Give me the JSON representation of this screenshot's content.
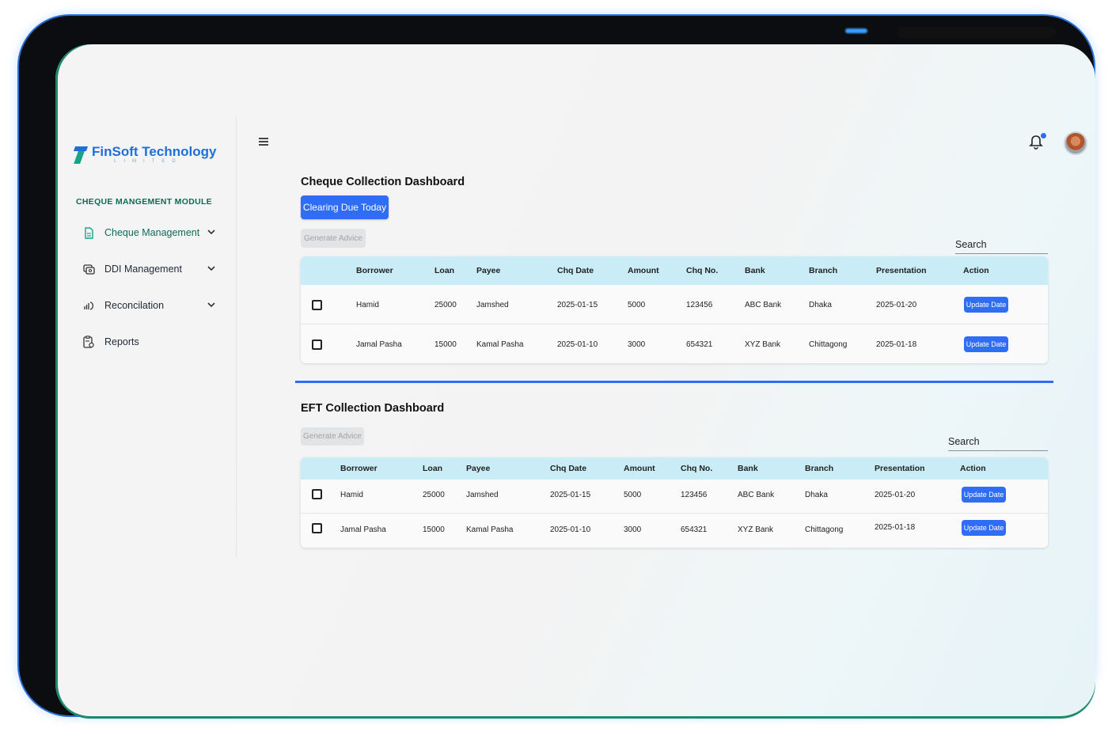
{
  "brand": {
    "name_part1": "FinSoft",
    "name_part2": "Technology",
    "subtitle": "LIMITED"
  },
  "sidebar": {
    "module_title": "CHEQUE MANGEMENT MODULE",
    "items": [
      {
        "label": "Cheque Management",
        "icon": "document-icon",
        "has_chevron": true,
        "active": true
      },
      {
        "label": "DDI Management",
        "icon": "ddi-icon",
        "has_chevron": true,
        "active": false
      },
      {
        "label": "Reconcilation",
        "icon": "reconcile-icon",
        "has_chevron": true,
        "active": false
      },
      {
        "label": "Reports",
        "icon": "report-clipboard-icon",
        "has_chevron": false,
        "active": false
      }
    ]
  },
  "topbar": {
    "menu_icon": "hamburger-icon",
    "notification_icon": "bell-icon",
    "avatar": "user-avatar"
  },
  "cheque": {
    "title": "Cheque Collection Dashboard",
    "clearing_button": "Clearing Due Today",
    "generate_button": "Generate Advice",
    "search_placeholder": "Search",
    "columns": [
      "Borrower",
      "Loan",
      "Payee",
      "Chq Date",
      "Amount",
      "Chq No.",
      "Bank",
      "Branch",
      "Presentation",
      "Action"
    ],
    "rows": [
      {
        "borrower": "Hamid",
        "loan": "25000",
        "payee": "Jamshed",
        "chq_date": "2025-01-15",
        "amount": "5000",
        "chq_no": "123456",
        "bank": "ABC Bank",
        "branch": "Dhaka",
        "presentation": "2025-01-20",
        "action": "Update Date"
      },
      {
        "borrower": "Jamal Pasha",
        "loan": "15000",
        "payee": "Kamal Pasha",
        "chq_date": "2025-01-10",
        "amount": "3000",
        "chq_no": "654321",
        "bank": "XYZ Bank",
        "branch": "Chittagong",
        "presentation": "2025-01-18",
        "action": "Update Date"
      }
    ]
  },
  "eft": {
    "title": "EFT Collection Dashboard",
    "generate_button": "Generate Advice",
    "search_placeholder": "Search",
    "columns": [
      "Borrower",
      "Loan",
      "Payee",
      "Chq Date",
      "Amount",
      "Chq No.",
      "Bank",
      "Branch",
      "Presentation",
      "Action"
    ],
    "rows": [
      {
        "borrower": "Hamid",
        "loan": "25000",
        "payee": "Jamshed",
        "chq_date": "2025-01-15",
        "amount": "5000",
        "chq_no": "123456",
        "bank": "ABC Bank",
        "branch": "Dhaka",
        "presentation": "2025-01-20",
        "action": "Update Date"
      },
      {
        "borrower": "Jamal Pasha",
        "loan": "15000",
        "payee": "Kamal Pasha",
        "chq_date": "2025-01-10",
        "amount": "3000",
        "chq_no": "654321",
        "bank": "XYZ Bank",
        "branch": "Chittagong",
        "presentation": "2025-01-18",
        "action": "Update Date"
      }
    ]
  },
  "colors": {
    "accent": "#2f6df6",
    "header_bg": "#c9ecf7",
    "module_green": "#0f6b54"
  }
}
